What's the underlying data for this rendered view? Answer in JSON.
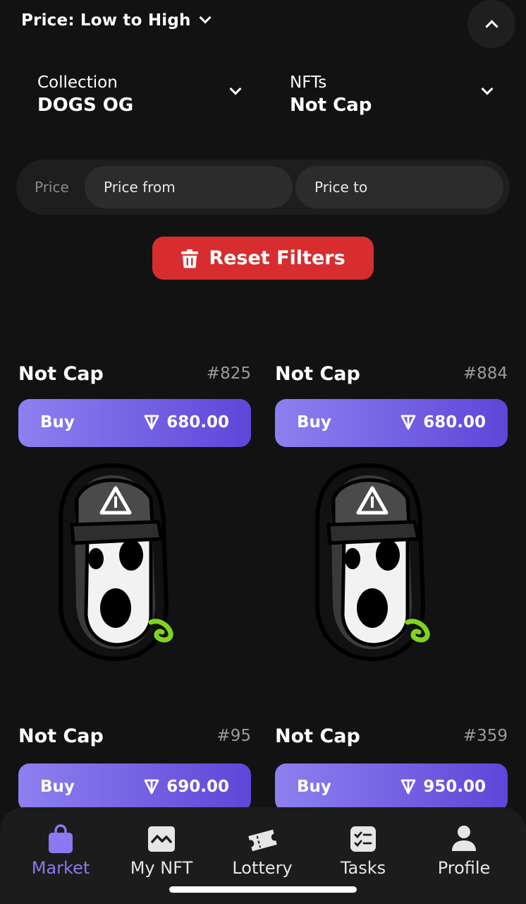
{
  "sort": {
    "label": "Price: Low to High"
  },
  "filters": {
    "collection": {
      "label": "Collection",
      "value": "DOGS OG"
    },
    "nfts": {
      "label": "NFTs",
      "value": "Not Cap"
    },
    "price": {
      "caption": "Price",
      "from_placeholder": "Price from",
      "to_placeholder": "Price to"
    },
    "reset_label": "Reset Filters"
  },
  "cards": [
    {
      "name": "Not Cap",
      "number": "#825",
      "buy_label": "Buy",
      "price": "680.00"
    },
    {
      "name": "Not Cap",
      "number": "#884",
      "buy_label": "Buy",
      "price": "680.00"
    },
    {
      "name": "Not Cap",
      "number": "#95",
      "buy_label": "Buy",
      "price": "690.00"
    },
    {
      "name": "Not Cap",
      "number": "#359",
      "buy_label": "Buy",
      "price": "950.00"
    }
  ],
  "nav": [
    {
      "label": "Market",
      "icon": "shopping-bag-icon",
      "active": true
    },
    {
      "label": "My NFT",
      "icon": "image-icon",
      "active": false
    },
    {
      "label": "Lottery",
      "icon": "ticket-icon",
      "active": false
    },
    {
      "label": "Tasks",
      "icon": "checklist-icon",
      "active": false
    },
    {
      "label": "Profile",
      "icon": "person-icon",
      "active": false
    }
  ],
  "colors": {
    "accent": "#8a79f0",
    "reset": "#d72d2f",
    "background": "#121212"
  }
}
